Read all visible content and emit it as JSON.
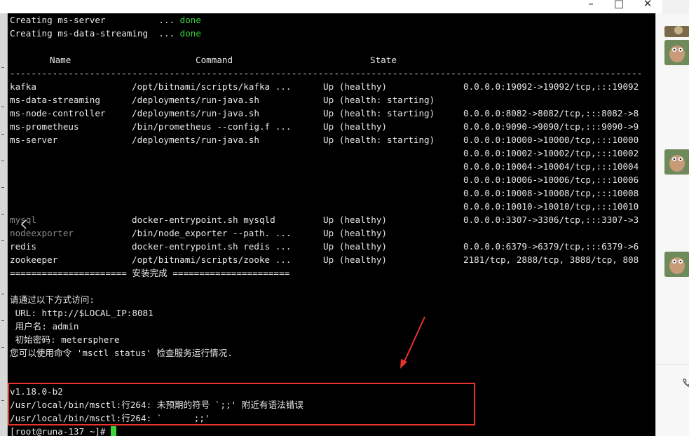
{
  "window": {
    "minimize": "–",
    "maximize": "□",
    "close": "✕"
  },
  "terminal": {
    "create_lines": [
      {
        "text": "Creating ms-server          ... ",
        "status": "done"
      },
      {
        "text": "Creating ms-data-streaming  ... ",
        "status": "done"
      }
    ],
    "table_header": {
      "name": "Name",
      "command": "Command",
      "state": "State"
    },
    "divider": "-----------------------------------------------------------------------------------------------------------------------",
    "rows": [
      {
        "name": "kafka",
        "command": "/opt/bitnami/scripts/kafka ...",
        "state": "Up (healthy)",
        "ports": "0.0.0.0:19092->19092/tcp,:::19092"
      },
      {
        "name": "ms-data-streaming",
        "command": "/deployments/run-java.sh",
        "state": "Up (health: starting)",
        "ports": ""
      },
      {
        "name": "ms-node-controller",
        "command": "/deployments/run-java.sh",
        "state": "Up (health: starting)",
        "ports": "0.0.0.0:8082->8082/tcp,:::8082->8"
      },
      {
        "name": "ms-prometheus",
        "command": "/bin/prometheus --config.f ...",
        "state": "Up (healthy)",
        "ports": "0.0.0.0:9090->9090/tcp,:::9090->9"
      },
      {
        "name": "ms-server",
        "command": "/deployments/run-java.sh",
        "state": "Up (health: starting)",
        "ports": "0.0.0.0:10000->10000/tcp,:::10000"
      },
      {
        "name": "",
        "command": "",
        "state": "",
        "ports": "0.0.0.0:10002->10002/tcp,:::10002"
      },
      {
        "name": "",
        "command": "",
        "state": "",
        "ports": "0.0.0.0:10004->10004/tcp,:::10004"
      },
      {
        "name": "",
        "command": "",
        "state": "",
        "ports": "0.0.0.0:10006->10006/tcp,:::10006"
      },
      {
        "name": "",
        "command": "",
        "state": "",
        "ports": "0.0.0.0:10008->10008/tcp,:::10008"
      },
      {
        "name": "",
        "command": "",
        "state": "",
        "ports": "0.0.0.0:10010->10010/tcp,:::10010"
      },
      {
        "name": "mysql",
        "command": "docker-entrypoint.sh mysqld",
        "state": "Up (healthy)",
        "ports": "0.0.0.0:3307->3306/tcp,:::3307->3"
      },
      {
        "name": "nodeexporter",
        "command": "/bin/node_exporter --path. ...",
        "state": "Up (healthy)",
        "ports": ""
      },
      {
        "name": "redis",
        "command": "docker-entrypoint.sh redis ...",
        "state": "Up (healthy)",
        "ports": "0.0.0.0:6379->6379/tcp,:::6379->6"
      },
      {
        "name": "zookeeper",
        "command": "/opt/bitnami/scripts/zooke ...",
        "state": "Up (healthy)",
        "ports": "2181/tcp, 2888/tcp, 3888/tcp, 808"
      }
    ],
    "install_done": "====================== 安装完成 ======================",
    "access_lines": [
      "请通过以下方式访问:",
      " URL: http://$LOCAL_IP:8081",
      " 用户名: admin",
      " 初始密码: metersphere",
      "您可以使用命令 'msctl status' 检查服务运行情况."
    ],
    "error_lines": [
      "v1.18.0-b2",
      "/usr/local/bin/msctl:行264: 未预期的符号 `;;' 附近有语法错误",
      "/usr/local/bin/msctl:行264: `      ;;'"
    ],
    "prompt": "[root@runa-137 ~]# "
  },
  "colors": {
    "terminal_bg": "#000000",
    "done": "#3cd33c",
    "highlight_box": "#e8322d"
  }
}
